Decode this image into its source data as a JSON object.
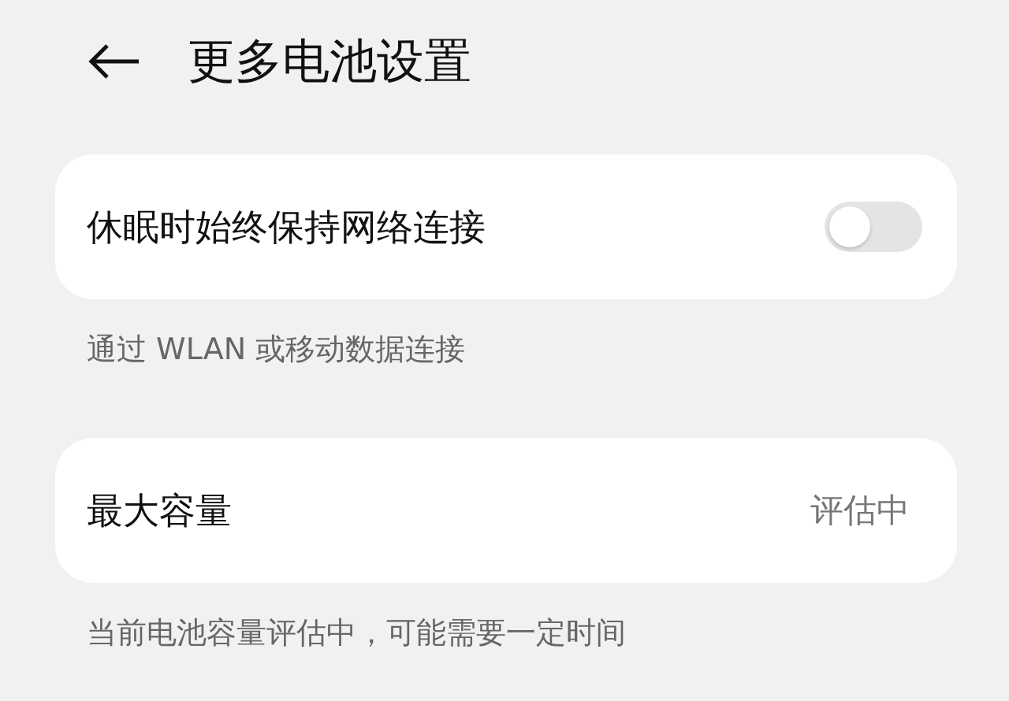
{
  "header": {
    "title": "更多电池设置"
  },
  "network_card": {
    "label": "休眠时始终保持网络连接",
    "on": false
  },
  "network_hint": "通过 WLAN 或移动数据连接",
  "capacity_card": {
    "label": "最大容量",
    "value": "评估中"
  },
  "capacity_hint": "当前电池容量评估中，可能需要一定时间"
}
